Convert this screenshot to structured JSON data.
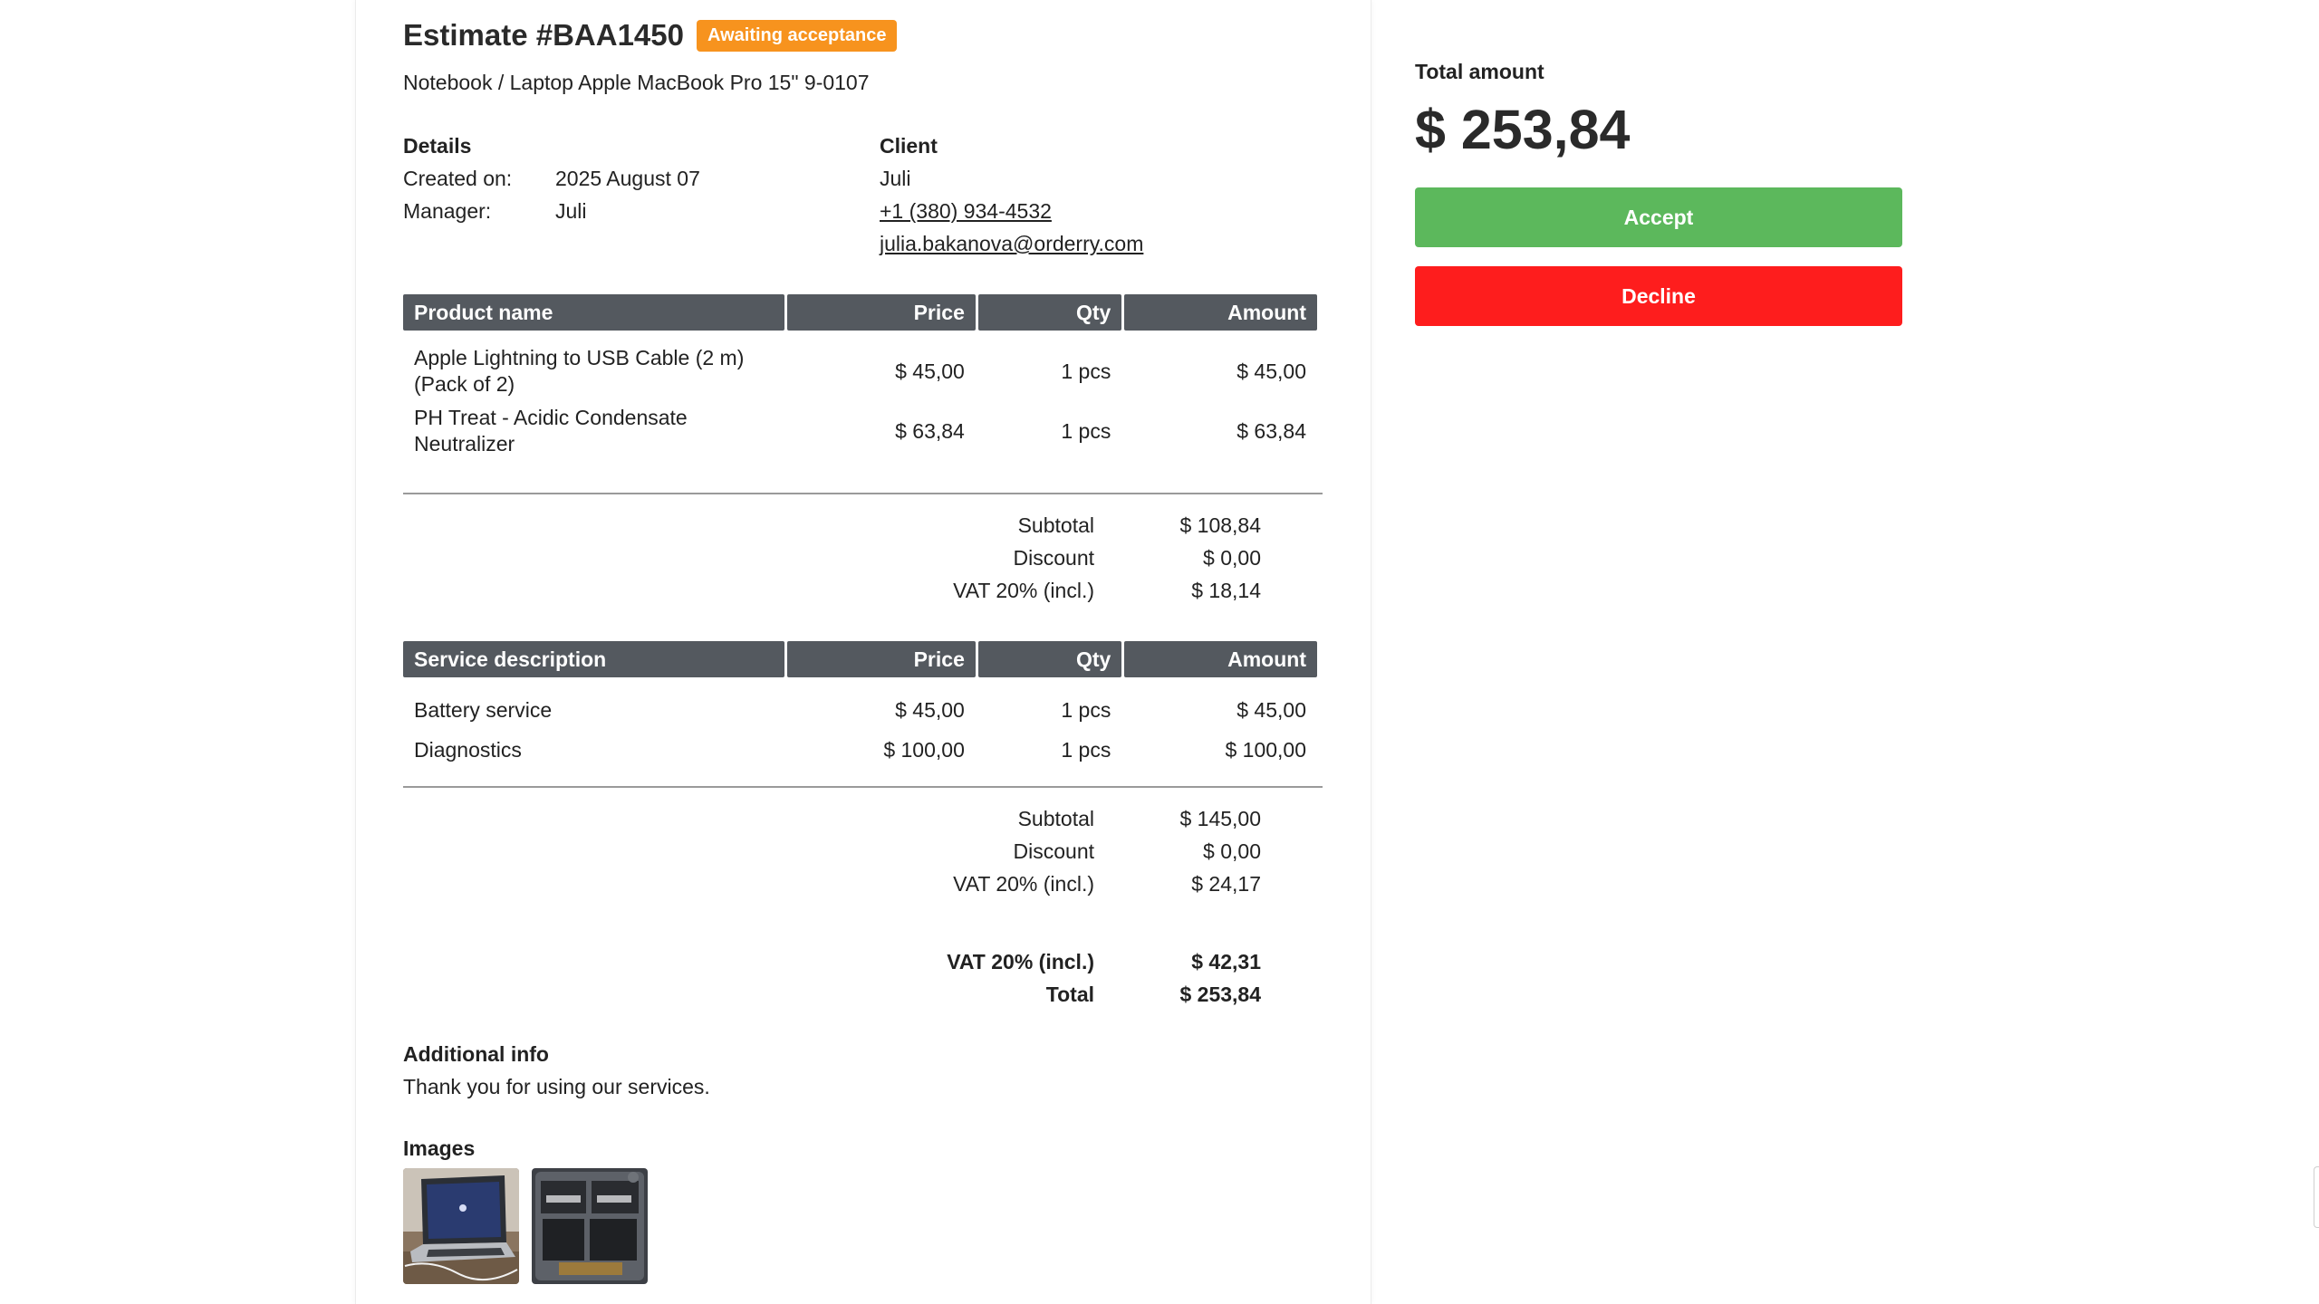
{
  "estimate": {
    "title": "Estimate #BAA1450",
    "status": "Awaiting acceptance",
    "device": "Notebook / Laptop Apple MacBook Pro 15\" 9-0107"
  },
  "details": {
    "heading": "Details",
    "created_label": "Created on:",
    "created_value": "2025 August 07",
    "manager_label": "Manager:",
    "manager_value": "Juli"
  },
  "client": {
    "heading": "Client",
    "name": "Juli",
    "phone": "+1 (380) 934-4532",
    "email": "julia.bakanova@orderry.com"
  },
  "products": {
    "headers": {
      "name": "Product name",
      "price": "Price",
      "qty": "Qty",
      "amount": "Amount"
    },
    "rows": [
      {
        "name_line1": "Apple Lightning to USB Cable (2 m)",
        "name_line2": "(Pack of 2)",
        "price": "$ 45,00",
        "qty": "1 pcs",
        "amount": "$ 45,00"
      },
      {
        "name_line1": "PH Treat - Acidic Condensate",
        "name_line2": "Neutralizer",
        "price": "$ 63,84",
        "qty": "1 pcs",
        "amount": "$ 63,84"
      }
    ],
    "totals": [
      {
        "label": "Subtotal",
        "value": "$ 108,84"
      },
      {
        "label": "Discount",
        "value": "$ 0,00"
      },
      {
        "label": "VAT 20% (incl.)",
        "value": "$ 18,14"
      }
    ]
  },
  "services": {
    "headers": {
      "name": "Service description",
      "price": "Price",
      "qty": "Qty",
      "amount": "Amount"
    },
    "rows": [
      {
        "name": "Battery service",
        "price": "$ 45,00",
        "qty": "1 pcs",
        "amount": "$ 45,00"
      },
      {
        "name": "Diagnostics",
        "price": "$ 100,00",
        "qty": "1 pcs",
        "amount": "$ 100,00"
      }
    ],
    "totals": [
      {
        "label": "Subtotal",
        "value": "$ 145,00"
      },
      {
        "label": "Discount",
        "value": "$ 0,00"
      },
      {
        "label": "VAT 20% (incl.)",
        "value": "$ 24,17"
      }
    ]
  },
  "grand_totals": [
    {
      "label": "VAT 20% (incl.)",
      "value": "$ 42,31"
    },
    {
      "label": "Total",
      "value": "$ 253,84"
    }
  ],
  "additional": {
    "heading": "Additional info",
    "text": "Thank you for using our services."
  },
  "images": {
    "heading": "Images",
    "items": [
      "laptop-photo",
      "laptop-internals-photo"
    ]
  },
  "side": {
    "total_label": "Total amount",
    "total_value": "$ 253,84",
    "accept_label": "Accept",
    "decline_label": "Decline"
  },
  "colors": {
    "badge": "#f7931e",
    "table_header": "#54595f",
    "accept": "#5cb85c",
    "decline": "#fe1d1d"
  }
}
